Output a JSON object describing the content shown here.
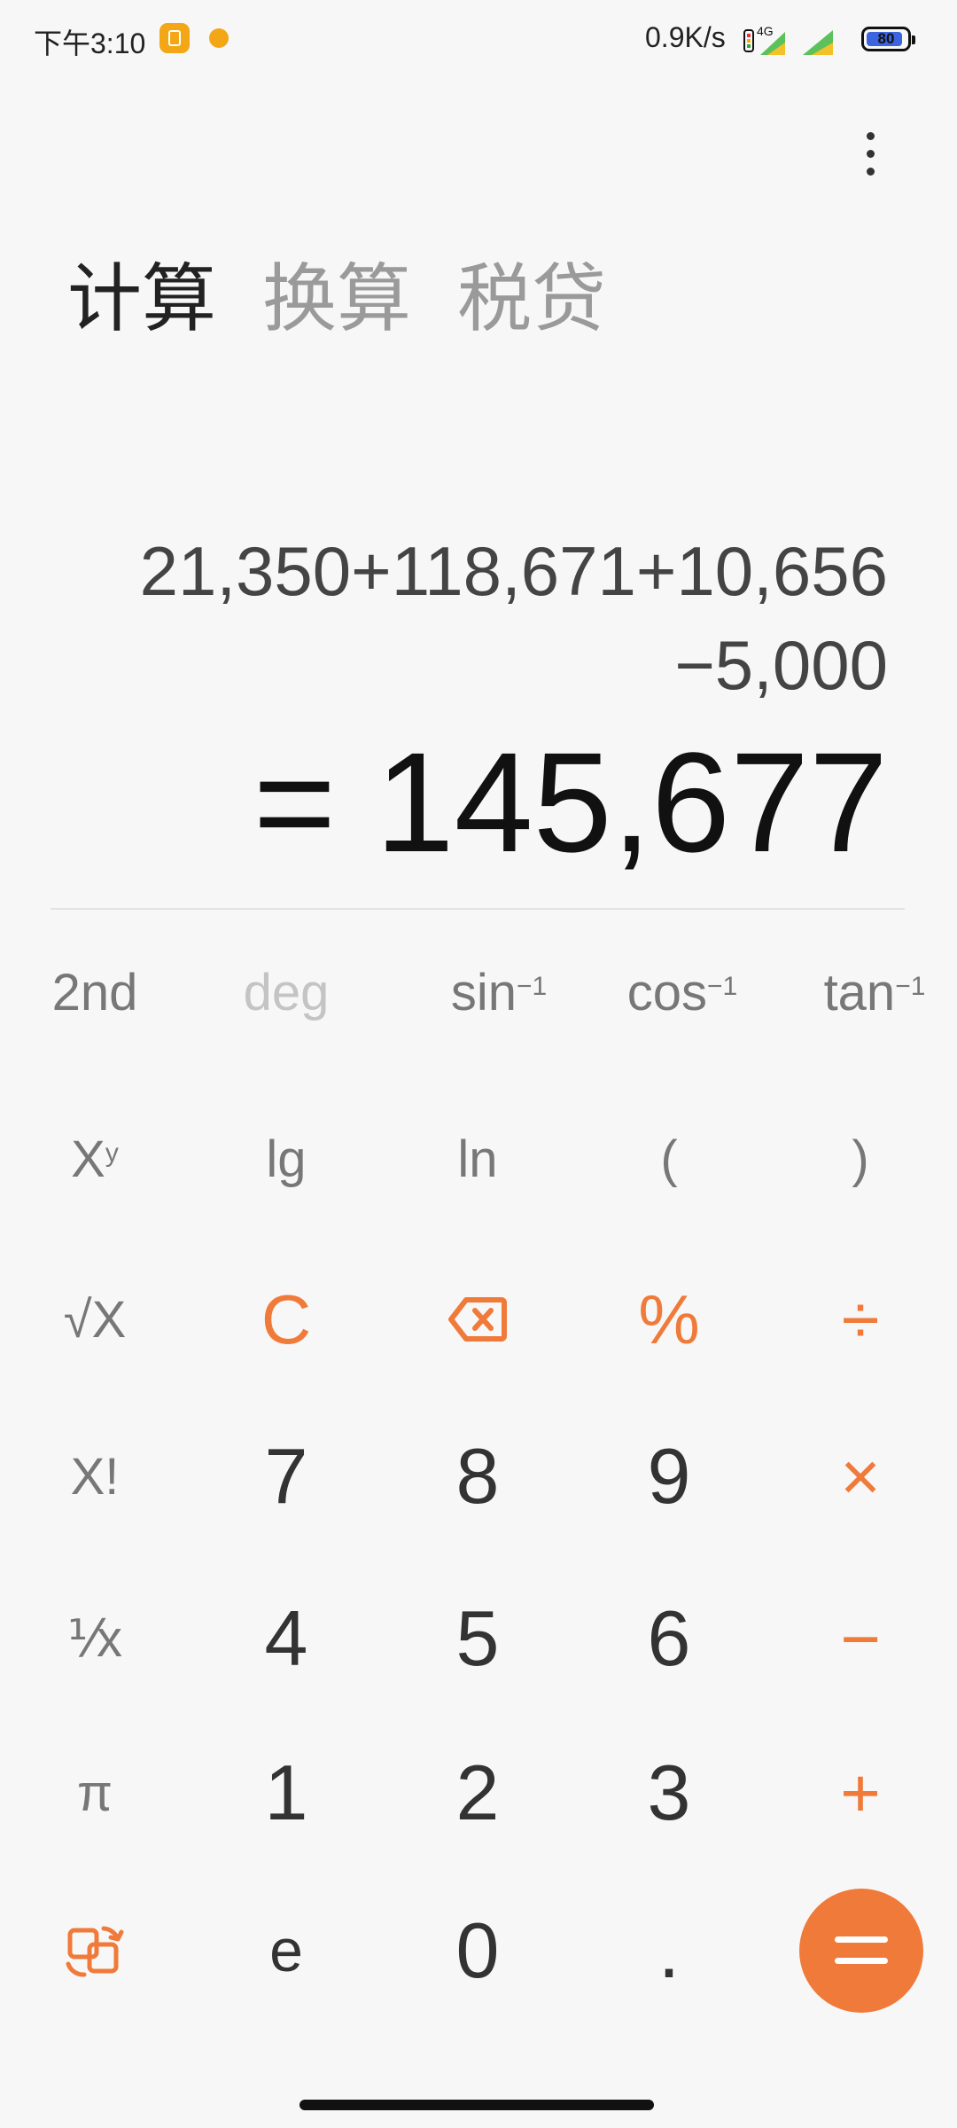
{
  "status_bar": {
    "time": "下午3:10",
    "net_speed": "0.9K/s",
    "network": "4G",
    "battery": "80"
  },
  "tabs": [
    {
      "label": "计算",
      "active": true
    },
    {
      "label": "换算",
      "active": false
    },
    {
      "label": "税贷",
      "active": false
    }
  ],
  "display": {
    "expression_line1": "21,350+118,671+10,656",
    "expression_line2": "−5,000",
    "result": "= 145,677"
  },
  "keypad": {
    "row1": {
      "k1": "2nd",
      "k2": "deg",
      "k3": "sin",
      "k4": "cos",
      "k5": "tan",
      "sup": "−1"
    },
    "row2": {
      "k1": "X",
      "k1_sup": "y",
      "k2": "lg",
      "k3": "ln",
      "k4": "(",
      "k5": ")"
    },
    "row3": {
      "k1": "√X",
      "k2": "C",
      "k4": "%",
      "k5": "÷"
    },
    "row4": {
      "k1": "X!",
      "k2": "7",
      "k3": "8",
      "k4": "9",
      "k5": "×"
    },
    "row5": {
      "k1": "⅟x",
      "k2": "4",
      "k3": "5",
      "k4": "6",
      "k5": "−"
    },
    "row6": {
      "k1": "π",
      "k2": "1",
      "k3": "2",
      "k4": "3",
      "k5": "+"
    },
    "row7": {
      "k2": "e",
      "k3": "0",
      "k4": "."
    }
  },
  "colors": {
    "accent": "#f07a3a",
    "background": "#f7f7f7"
  },
  "icons": {
    "backspace": "backspace-icon",
    "switch_mode": "rotate-switch-icon",
    "overflow_menu": "more-vertical-icon"
  }
}
